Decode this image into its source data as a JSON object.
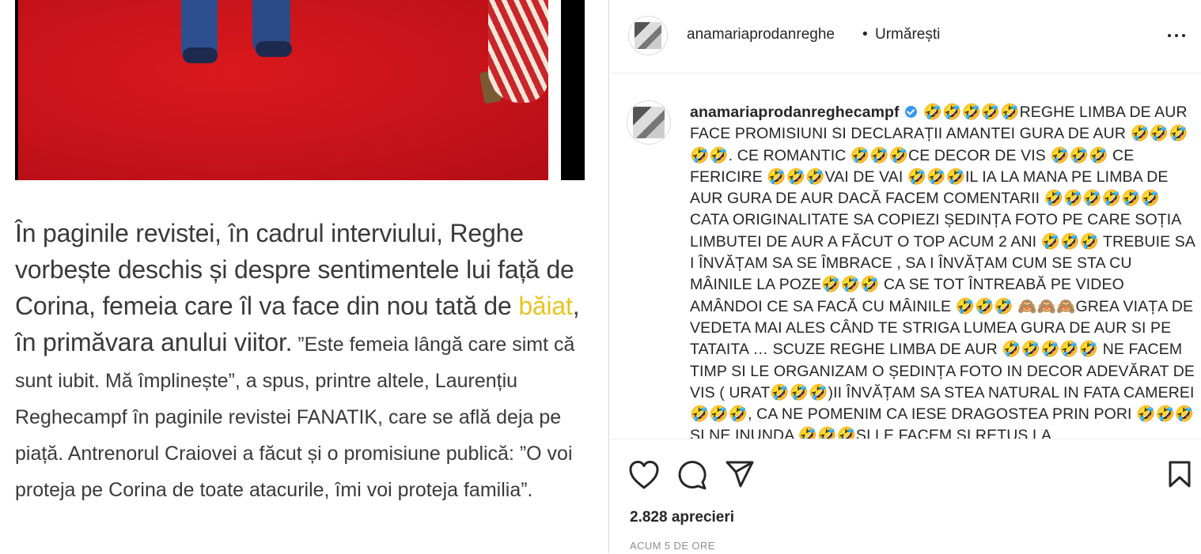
{
  "article": {
    "para_big_1": "În paginile revistei, în cadrul interviului, Reghe vorbește deschis și despre sentimentele lui față de Corina, femeia care îl va face din nou tată de ",
    "para_link": "băiat",
    "para_big_2": ", în primăvara anului viitor.",
    "para_small": " ”Este femeia lângă care simt că sunt iubit. Mă împlinește”, a spus, printre altele, Laurențiu Reghecampf în paginile revistei FANATIK, care se află deja pe piață. Antrenorul Craiovei a făcut și o promisiune publică: ”O voi proteja pe Corina de toate atacurile, îmi voi proteja familia”."
  },
  "header": {
    "username": "anamariaprodanreghe",
    "separator": "•",
    "follow_status": "Urmărești"
  },
  "caption": {
    "username": "anamariaprodanreghecampf",
    "text": "🤣🤣🤣🤣🤣REGHE LIMBA DE AUR FACE PROMISIUNI SI DECLARAȚII AMANTEI GURA DE AUR 🤣🤣🤣🤣🤣. CE ROMANTIC 🤣🤣🤣CE DECOR DE VIS 🤣🤣🤣 CE FERICIRE 🤣🤣🤣VAI DE VAI 🤣🤣🤣IL IA LA MANA PE LIMBA DE AUR GURA DE AUR DACĂ FACEM COMENTARII 🤣🤣🤣🤣🤣🤣 CATA ORIGINALITATE SA COPIEZI ȘEDINȚA FOTO PE CARE SOȚIA LIMBUTEI DE AUR A FĂCUT O TOP ACUM 2 ANI 🤣🤣🤣 TREBUIE SA I ÎNVĂȚAM SA SE ÎMBRACE , SA I ÎNVĂȚAM CUM SE STA CU MÂINILE LA POZE🤣🤣🤣 CA SE TOT ÎNTREABĂ PE VIDEO AMÂNDOI CE SA FACĂ CU MÂINILE 🤣🤣🤣 🙈🙈🙈GREA VIAȚA DE VEDETA MAI ALES CÂND TE STRIGA LUMEA GURA DE AUR SI PE TATAITA … SCUZE REGHE LIMBA DE AUR 🤣🤣🤣🤣🤣 NE FACEM TIMP SI LE ORGANIZAM O ȘEDINȚA FOTO IN DECOR ADEVĂRAT DE VIS ( URAT🤣🤣🤣)II ÎNVĂȚAM SA STEA NATURAL IN FATA CAMEREI 🤣🤣🤣, CA NE POMENIM CA IESE DRAGOSTEA PRIN PORI 🤣🤣🤣SI NE INUNDA 🤣🤣🤣SI LE FACEM SI RETUS LA"
  },
  "actions": {
    "icons": [
      "heart-icon",
      "comment-icon",
      "share-icon",
      "bookmark-icon"
    ]
  },
  "stats": {
    "likes": "2.828 aprecieri",
    "timestamp": "ACUM 5 DE ORE"
  }
}
